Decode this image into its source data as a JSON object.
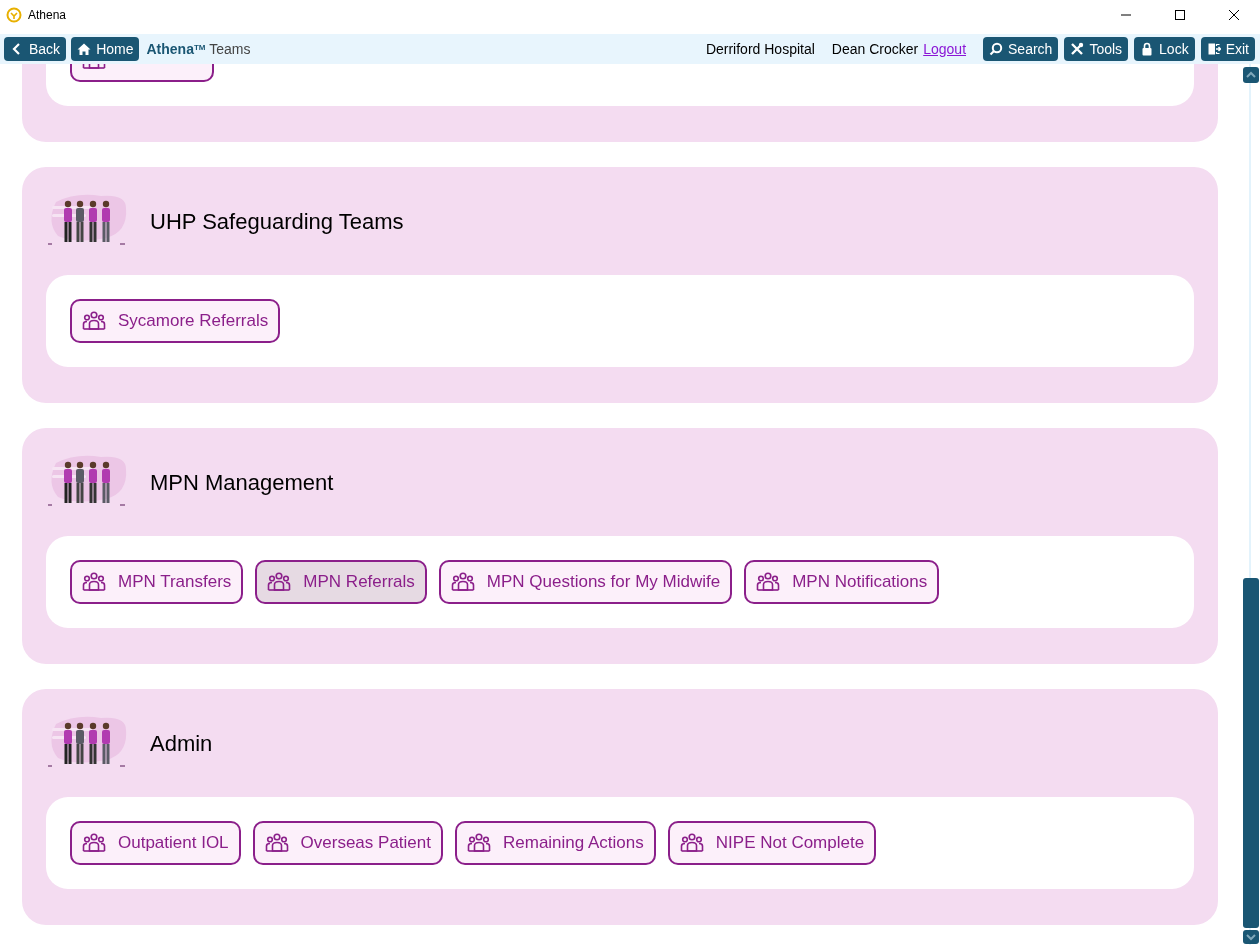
{
  "window": {
    "title": "Athena"
  },
  "toolbar": {
    "left_buttons": [
      {
        "kind": "back",
        "label": "Back"
      },
      {
        "kind": "home",
        "label": "Home"
      }
    ],
    "brand": "Athena",
    "trademark": "TM",
    "page": "Teams",
    "location": "Derriford Hospital",
    "user": "Dean Crocker",
    "logout": "Logout",
    "right_buttons": [
      {
        "kind": "search",
        "label": "Search"
      },
      {
        "kind": "tools",
        "label": "Tools"
      },
      {
        "kind": "lock",
        "label": "Lock"
      },
      {
        "kind": "exit",
        "label": "Exit"
      }
    ]
  },
  "sections": [
    {
      "buttons": [
        {
          "selected": false
        }
      ]
    },
    {
      "title": "UHP Safeguarding Teams",
      "buttons": [
        {
          "label": "Sycamore Referrals",
          "selected": false
        }
      ]
    },
    {
      "title": "MPN Management",
      "buttons": [
        {
          "label": "MPN Transfers",
          "selected": false
        },
        {
          "label": "MPN Referrals",
          "selected": true
        },
        {
          "label": "MPN Questions for My Midwife",
          "selected": false
        },
        {
          "label": "MPN Notifications",
          "selected": false
        }
      ]
    },
    {
      "title": "Admin",
      "buttons": [
        {
          "label": "Outpatient IOL",
          "selected": false
        },
        {
          "label": "Overseas Patient",
          "selected": false
        },
        {
          "label": "Remaining Actions",
          "selected": false
        },
        {
          "label": "NIPE Not Complete",
          "selected": false
        }
      ]
    }
  ]
}
